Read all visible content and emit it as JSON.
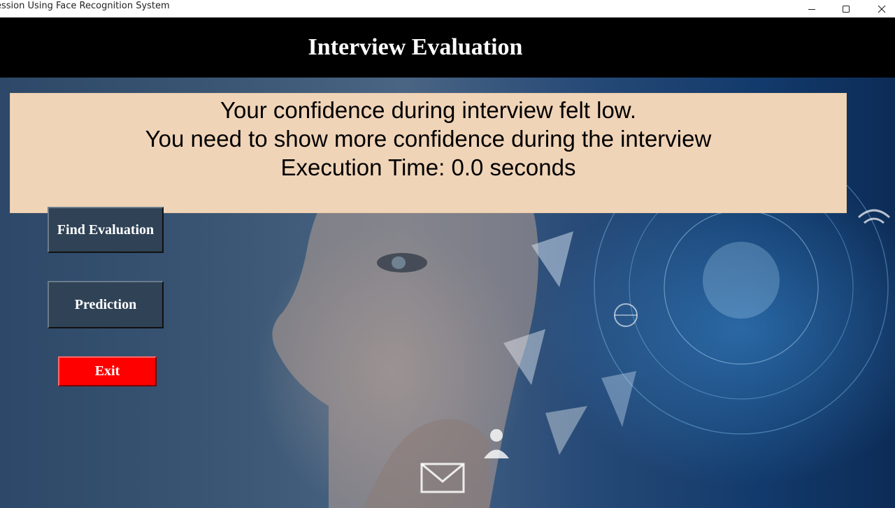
{
  "window": {
    "title": "ession Using Face Recognition System",
    "controls": {
      "minimize_icon": "minimize-icon",
      "maximize_icon": "maximize-icon",
      "close_icon": "close-icon"
    }
  },
  "header": {
    "title": "Interview Evaluation"
  },
  "message": {
    "line1": "Your confidence during interview felt low.",
    "line2": "You need to show more confidence during the interview",
    "line3": "Execution Time: 0.0 seconds"
  },
  "buttons": {
    "find_evaluation": "Find Evaluation",
    "prediction": "Prediction",
    "exit": "Exit"
  },
  "colors": {
    "header_bg": "#000000",
    "message_bg": "#f0d4b8",
    "button_bg": "#2f4256",
    "exit_bg": "#ff0000"
  }
}
